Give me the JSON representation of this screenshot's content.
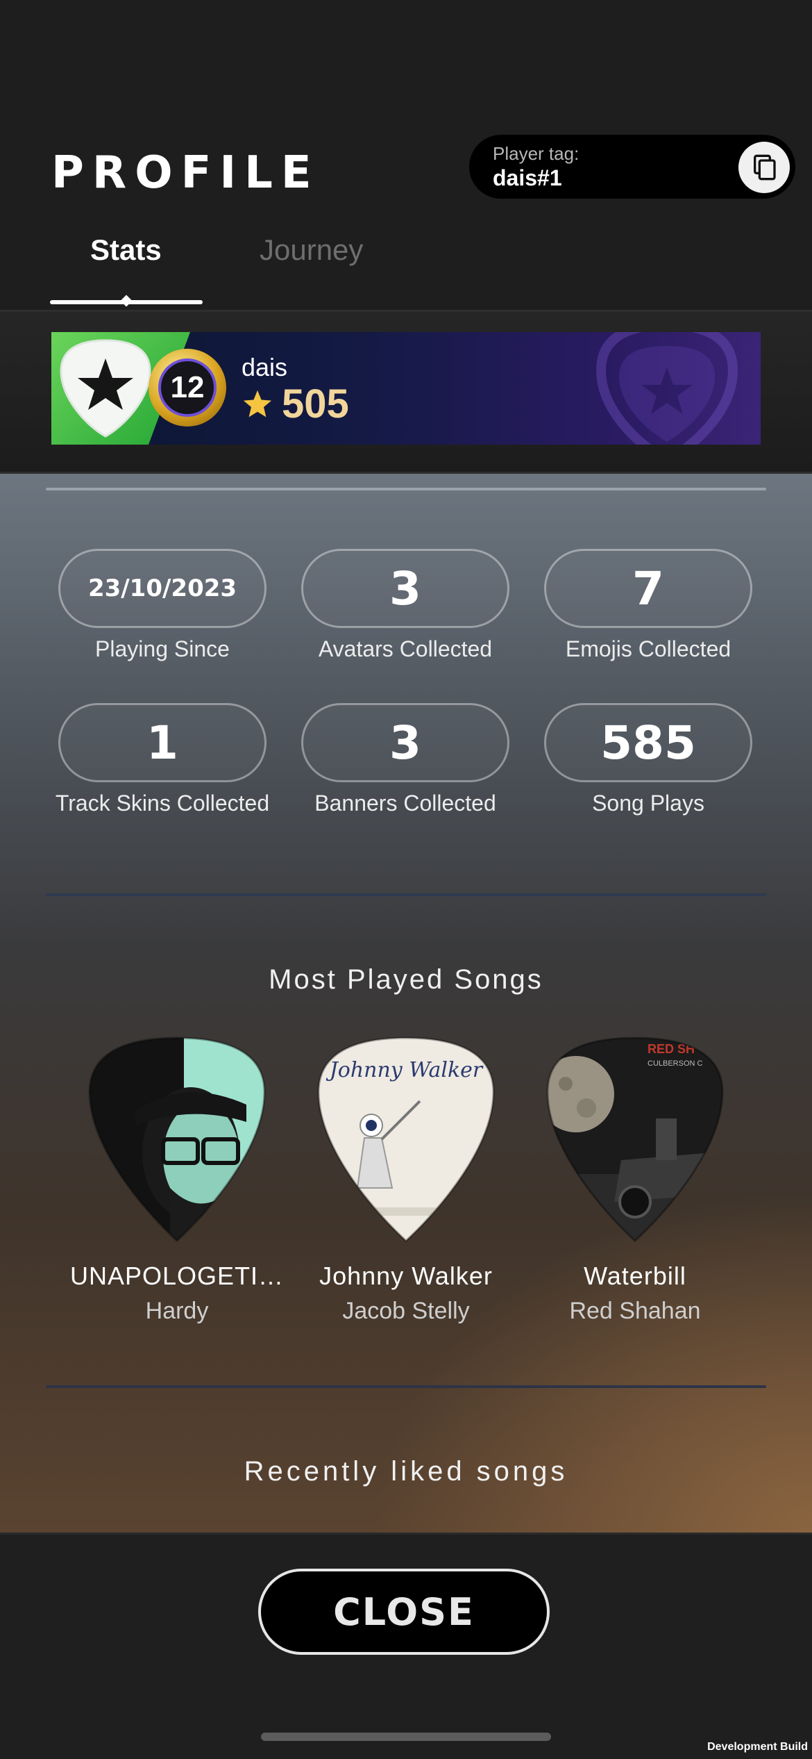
{
  "header": {
    "title": "PROFILE",
    "player_tag_label": "Player tag:",
    "player_tag_value": "dais#1"
  },
  "tabs": [
    {
      "label": "Stats",
      "active": true
    },
    {
      "label": "Journey",
      "active": false
    }
  ],
  "banner": {
    "level": "12",
    "username": "dais",
    "score": "505"
  },
  "stats": [
    {
      "value": "23/10/2023",
      "label": "Playing Since"
    },
    {
      "value": "3",
      "label": "Avatars Collected"
    },
    {
      "value": "7",
      "label": "Emojis Collected"
    },
    {
      "value": "1",
      "label": "Track Skins Collected"
    },
    {
      "value": "3",
      "label": "Banners Collected"
    },
    {
      "value": "585",
      "label": "Song Plays"
    }
  ],
  "most_played": {
    "title": "Most Played Songs",
    "songs": [
      {
        "title": "UNAPOLOGETI…",
        "artist": "Hardy"
      },
      {
        "title": "Johnny Walker",
        "artist": "Jacob Stelly",
        "art_text": "Johnny Walker"
      },
      {
        "title": "Waterbill",
        "artist": "Red Shahan",
        "art_text": "RED SH",
        "art_subtext": "CULBERSON C"
      }
    ]
  },
  "recently_liked": {
    "title": "Recently liked songs"
  },
  "footer": {
    "close_label": "CLOSE",
    "build_label": "Development Build"
  },
  "colors": {
    "background": "#1e1e1e",
    "banner_gold": "#f2d59a",
    "star": "#f5c542",
    "accent_green": "#3cc043"
  }
}
